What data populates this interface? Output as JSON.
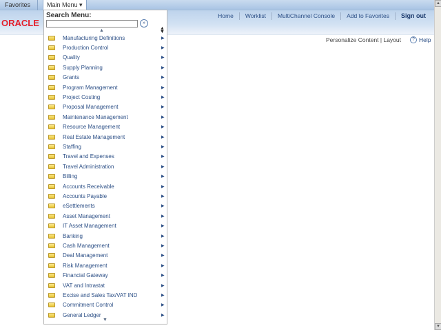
{
  "topbar": {
    "favorites": "Favorites ▾",
    "main_menu": "Main Menu ▾"
  },
  "header": {
    "logo": "ORACLE",
    "links": [
      "Home",
      "Worklist",
      "MultiChannel Console",
      "Add to Favorites"
    ],
    "sign_out": "Sign out"
  },
  "page": {
    "personalize": "Personalize Content | Layout",
    "help": "Help"
  },
  "menu": {
    "title": "Search Menu:",
    "search_value": "",
    "items": [
      "Manufacturing Definitions",
      "Production Control",
      "Quality",
      "Supply Planning",
      "Grants",
      "Program Management",
      "Project Costing",
      "Proposal Management",
      "Maintenance Management",
      "Resource Management",
      "Real Estate Management",
      "Staffing",
      "Travel and Expenses",
      "Travel Administration",
      "Billing",
      "Accounts Receivable",
      "Accounts Payable",
      "eSettlements",
      "Asset Management",
      "IT Asset Management",
      "Banking",
      "Cash Management",
      "Deal Management",
      "Risk Management",
      "Financial Gateway",
      "VAT and Intrastat",
      "Excise and Sales Tax/VAT IND",
      "Commitment Control",
      "General Ledger"
    ]
  }
}
